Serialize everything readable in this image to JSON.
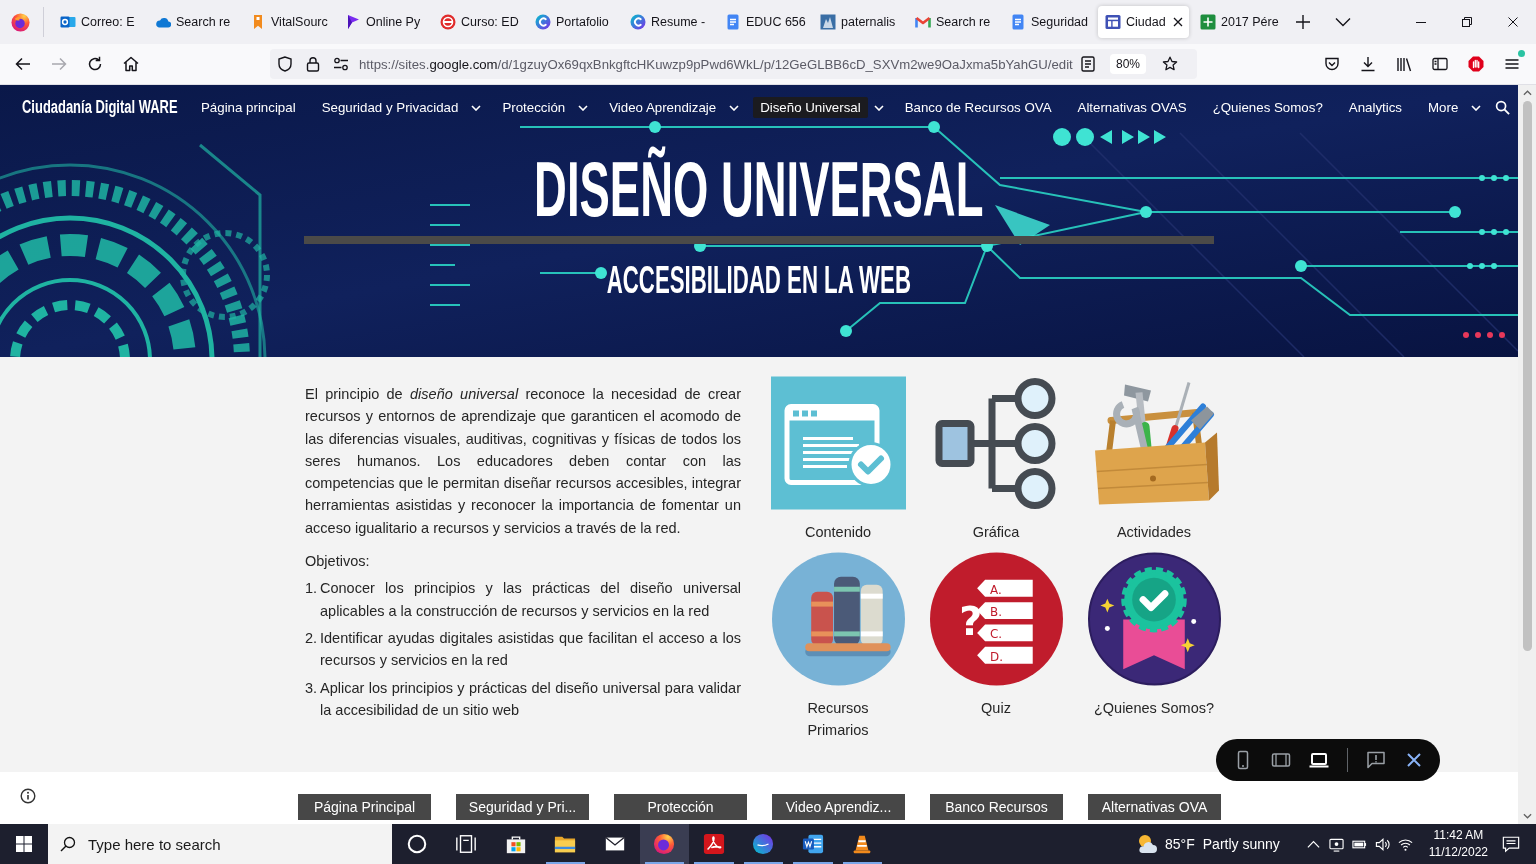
{
  "browser": {
    "tabs": [
      {
        "kind": "outlook",
        "title": "Correo: E",
        "selected": false
      },
      {
        "kind": "cloud",
        "title": "Search re",
        "selected": false
      },
      {
        "kind": "tag",
        "title": "VitalSourc",
        "selected": false
      },
      {
        "kind": "pennant",
        "title": "Online Py",
        "selected": false
      },
      {
        "kind": "seal",
        "title": "Curso: ED",
        "selected": false
      },
      {
        "kind": "circle",
        "title": "Portafolio",
        "selected": false
      },
      {
        "kind": "circle",
        "title": "Resume -",
        "selected": false
      },
      {
        "kind": "doc",
        "title": "EDUC 656",
        "selected": false
      },
      {
        "kind": "picture",
        "title": "paternalis",
        "selected": false
      },
      {
        "kind": "mail",
        "title": "Search re",
        "selected": false
      },
      {
        "kind": "doc",
        "title": "Seguridad",
        "selected": false
      },
      {
        "kind": "sites",
        "title": "Ciudad",
        "selected": true
      },
      {
        "kind": "sheet",
        "title": "2017 Pére",
        "selected": false
      }
    ],
    "nav_buttons": [
      {
        "kind": "back",
        "disabled": false
      },
      {
        "kind": "forward",
        "disabled": true
      },
      {
        "kind": "reload",
        "disabled": false
      },
      {
        "kind": "home",
        "disabled": false
      }
    ],
    "address": {
      "prefix": "https://sites.",
      "domain": "google.com",
      "path": "/d/1gzuyOx69qxBnkgftcHKuwzp9pPwd6WkL/p/12GeGLBB6cD_SXVm2we9OaJxma5bYahGU/edit"
    },
    "zoom": "80%",
    "menu_notification": true
  },
  "site": {
    "title": "Ciudadanía Digital WARE",
    "nav": [
      {
        "label": "Página principal",
        "has_menu": false,
        "selected": false
      },
      {
        "label": "Seguridad y Privacidad",
        "has_menu": true,
        "selected": false
      },
      {
        "label": "Protección",
        "has_menu": true,
        "selected": false
      },
      {
        "label": "Video Aprendizaje",
        "has_menu": true,
        "selected": false
      },
      {
        "label": "Diseño Universal",
        "has_menu": true,
        "selected": true
      },
      {
        "label": "Banco de Recursos OVA",
        "has_menu": false,
        "selected": false
      },
      {
        "label": "Alternativas OVAS",
        "has_menu": false,
        "selected": false
      },
      {
        "label": "¿Quienes Somos?",
        "has_menu": false,
        "selected": false
      },
      {
        "label": "Analytics",
        "has_menu": false,
        "selected": false
      },
      {
        "label": "More",
        "has_menu": true,
        "selected": false
      }
    ]
  },
  "hero": {
    "title": "DISEÑO UNIVERSAL",
    "subtitle": "ACCESIBILIDAD EN LA WEB"
  },
  "intro": "El principio de *diseño universal* reconoce la necesidad de crear recursos y entornos de aprendizaje que garanticen el acomodo de las diferencias visuales, auditivas, cognitivas y físicas de todos los seres humanos. Los educadores deben contar con las competencias que le permitan diseñar recursos accesibles, integrar herramientas asistidas y reconocer la importancia de fomentar un acceso igualitario a recursos y servicios a través de la red.",
  "objectives": {
    "heading": "Objetivos:",
    "items": [
      {
        "number": "1.",
        "text": "Conocer los principios y las prácticas del diseño universal aplicables a la construcción de recursos y servicios en la red"
      },
      {
        "number": "2.",
        "text": "Identificar ayudas digitales asistidas que facilitan el acceso a los recursos y servicios en la red"
      },
      {
        "number": "3.",
        "text": "Aplicar los principios y prácticas del diseño universal para validar la accesibilidad de un sitio web"
      }
    ]
  },
  "tiles": [
    {
      "kind": "document",
      "label": "Contenido"
    },
    {
      "kind": "diagram",
      "label": "Gráfica"
    },
    {
      "kind": "toolbox",
      "label": "Actividades"
    },
    {
      "kind": "books",
      "label": "Recursos Primarios"
    },
    {
      "kind": "quiz",
      "label": "Quiz",
      "symbol": "?",
      "options": [
        "A.",
        "B.",
        "C.",
        "D."
      ]
    },
    {
      "kind": "badge",
      "label": "¿Quienes Somos?"
    }
  ],
  "preview_toolbar": {
    "devices": [
      {
        "kind": "phone",
        "selected": false
      },
      {
        "kind": "tablet",
        "selected": false
      },
      {
        "kind": "laptop",
        "selected": true
      }
    ]
  },
  "footer_buttons": [
    "Página Principal",
    "Seguridad y Pri...",
    "Protección",
    "Video Aprendiz...",
    "Banco Recursos",
    "Alternativas OVA"
  ],
  "taskbar": {
    "search_placeholder": "Type here to search",
    "apps": [
      {
        "kind": "cortana",
        "running": false,
        "selected": false
      },
      {
        "kind": "taskview",
        "running": false,
        "selected": false
      },
      {
        "kind": "store",
        "running": false,
        "selected": false
      },
      {
        "kind": "explorer",
        "running": true,
        "selected": false
      },
      {
        "kind": "mail",
        "running": false,
        "selected": false
      },
      {
        "kind": "firefox",
        "running": true,
        "selected": true
      },
      {
        "kind": "acrobat",
        "running": true,
        "selected": false
      },
      {
        "kind": "canva",
        "running": true,
        "selected": false
      },
      {
        "kind": "word",
        "running": true,
        "selected": false
      },
      {
        "kind": "vlc",
        "running": true,
        "selected": false
      }
    ],
    "weather": {
      "temperature": "85°F",
      "condition": "Partly sunny"
    },
    "time": "11:42 AM",
    "date": "11/12/2022"
  }
}
